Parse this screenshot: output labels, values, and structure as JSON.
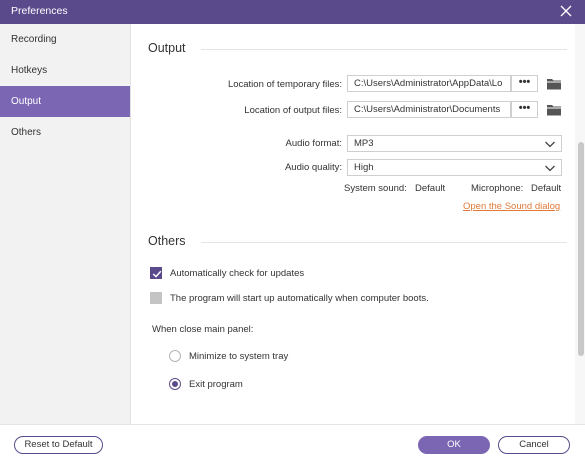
{
  "window": {
    "title": "Preferences"
  },
  "sidebar": {
    "items": [
      {
        "label": "Recording"
      },
      {
        "label": "Hotkeys"
      },
      {
        "label": "Output"
      },
      {
        "label": "Others"
      }
    ],
    "active": "Output"
  },
  "output": {
    "heading": "Output",
    "temp_files": {
      "label": "Location of temporary files:",
      "value": "C:\\Users\\Administrator\\AppData\\Lo"
    },
    "output_files": {
      "label": "Location of output files:",
      "value": "C:\\Users\\Administrator\\Documents"
    },
    "audio_format": {
      "label": "Audio format:",
      "value": "MP3"
    },
    "audio_quality": {
      "label": "Audio quality:",
      "value": "High"
    },
    "system_sound": {
      "label": "System sound:",
      "value": "Default"
    },
    "microphone": {
      "label": "Microphone:",
      "value": "Default"
    },
    "sound_dialog_link": "Open the Sound dialog",
    "browse_label": "•••"
  },
  "others": {
    "heading": "Others",
    "auto_update": {
      "label": "Automatically check for updates",
      "checked": true
    },
    "auto_start": {
      "label": "The program will start up automatically when computer boots.",
      "checked": false
    },
    "close_panel_label": "When close main panel:",
    "options": [
      {
        "label": "Minimize to system tray",
        "selected": false
      },
      {
        "label": "Exit program",
        "selected": true
      }
    ]
  },
  "footer": {
    "reset_label": "Reset to Default",
    "ok_label": "OK",
    "cancel_label": "Cancel"
  },
  "colors": {
    "titlebar": "#5a4a8c",
    "accent": "#7a66b3",
    "link": "#e07a38"
  }
}
